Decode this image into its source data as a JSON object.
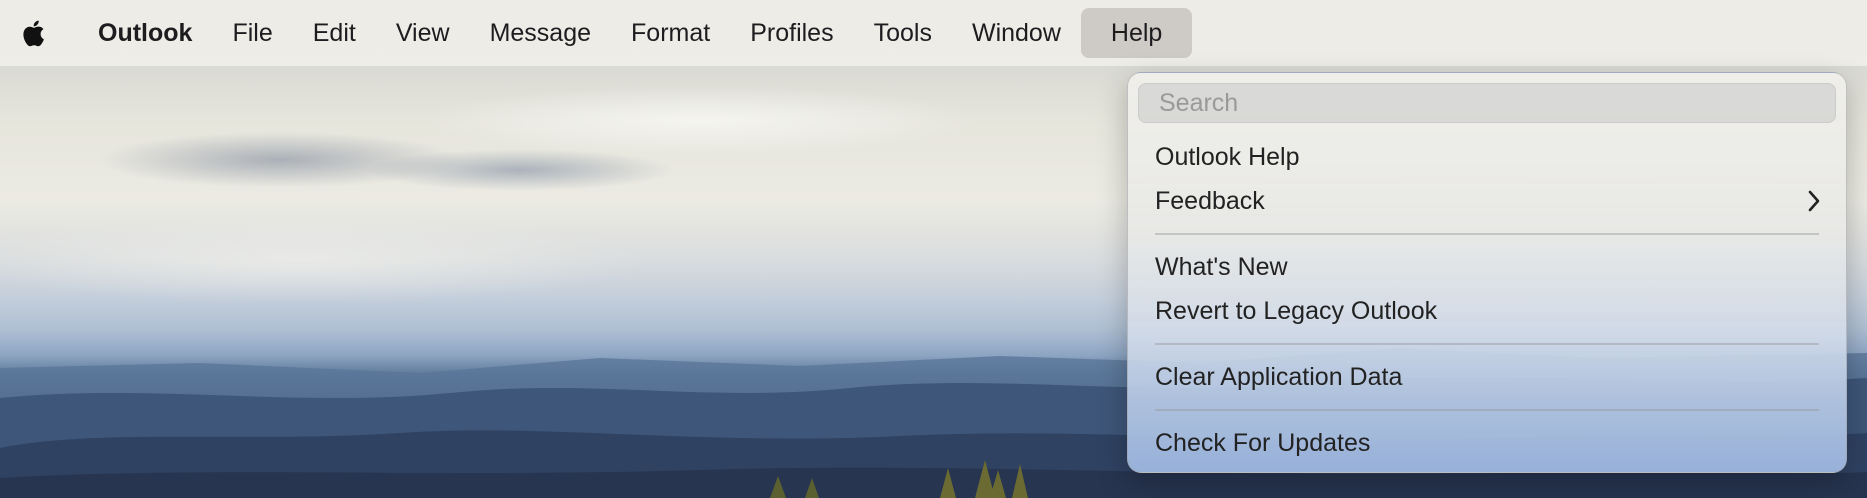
{
  "menubar": {
    "apple_icon": "apple-logo-icon",
    "app_name": "Outlook",
    "items": [
      "File",
      "Edit",
      "View",
      "Message",
      "Format",
      "Profiles",
      "Tools",
      "Window",
      "Help"
    ],
    "active_item": "Help"
  },
  "help_menu": {
    "search_placeholder": "Search",
    "items": [
      {
        "label": "Outlook Help"
      },
      {
        "label": "Feedback",
        "submenu_icon": "chevron-right-icon"
      },
      {
        "label": "What's New"
      },
      {
        "label": "Revert to Legacy Outlook"
      },
      {
        "label": "Clear Application Data"
      },
      {
        "label": "Check For Updates"
      }
    ]
  }
}
